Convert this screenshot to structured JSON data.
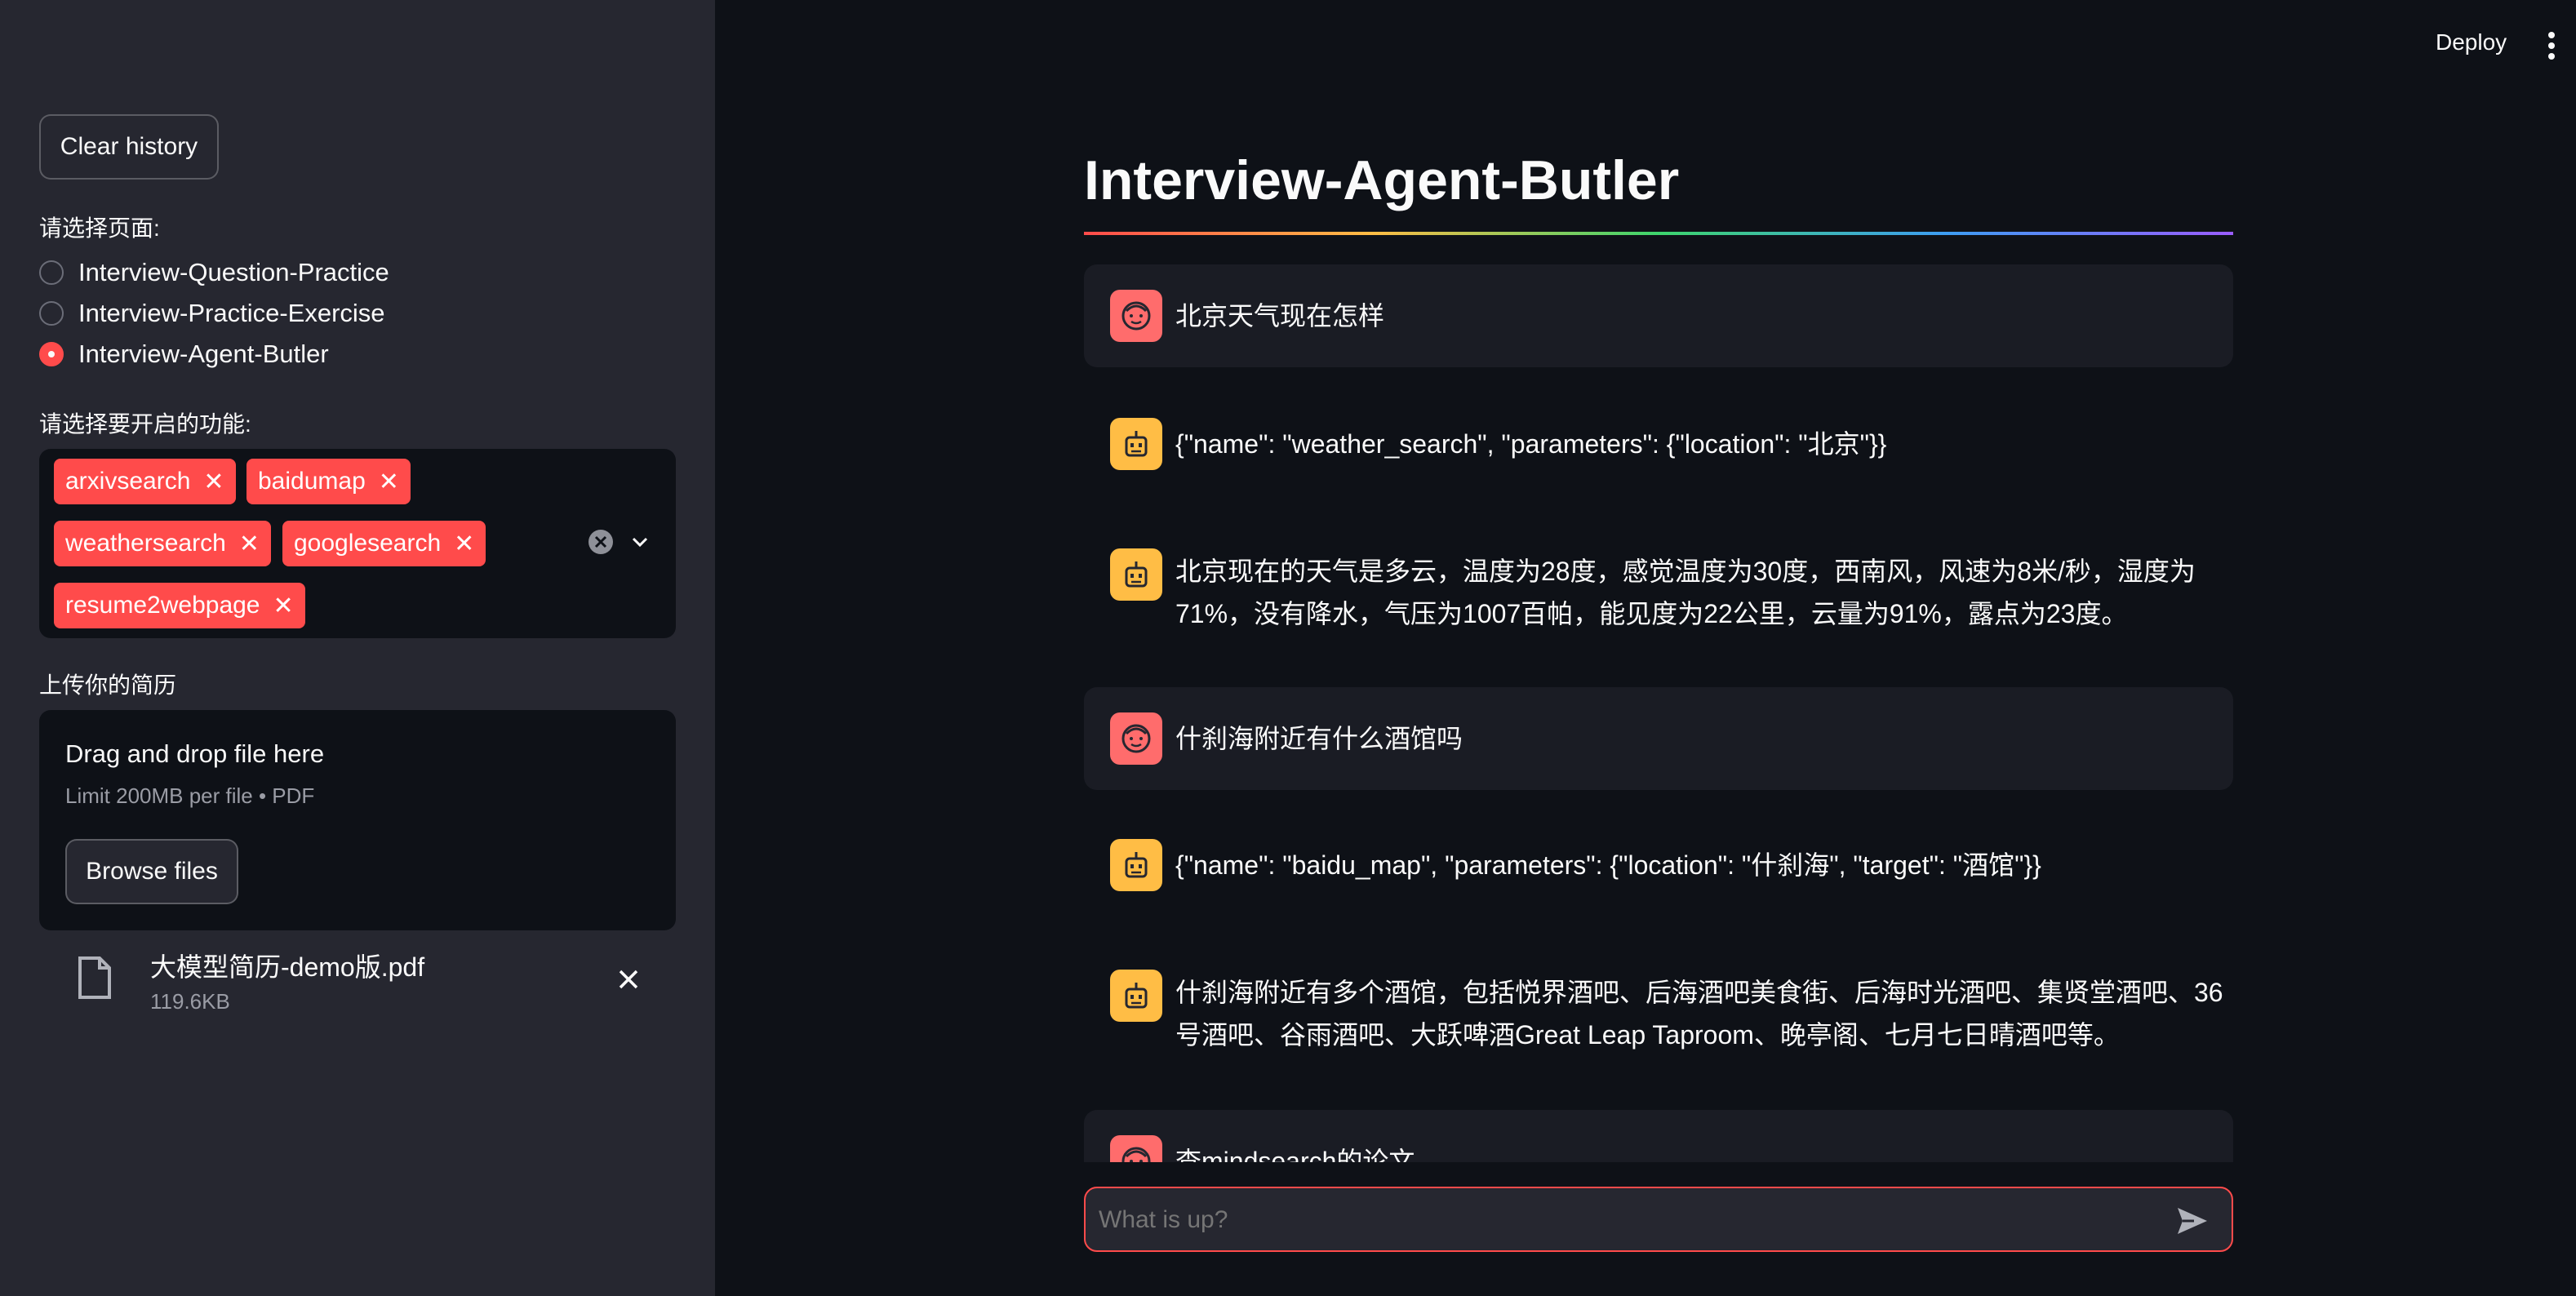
{
  "header": {
    "deploy_label": "Deploy"
  },
  "sidebar": {
    "clear_history_label": "Clear history",
    "page_select_label": "请选择页面:",
    "pages": [
      {
        "label": "Interview-Question-Practice",
        "selected": false
      },
      {
        "label": "Interview-Practice-Exercise",
        "selected": false
      },
      {
        "label": "Interview-Agent-Butler",
        "selected": true
      }
    ],
    "features_label": "请选择要开启的功能:",
    "features": [
      "arxivsearch",
      "baidumap",
      "weathersearch",
      "googlesearch",
      "resume2webpage"
    ],
    "upload_label": "上传你的简历",
    "uploader": {
      "drag_text": "Drag and drop file here",
      "limit_text": "Limit 200MB per file • PDF",
      "browse_label": "Browse files"
    },
    "uploaded_file": {
      "name": "大模型简历-demo版.pdf",
      "size": "119.6KB"
    }
  },
  "main": {
    "title": "Interview-Agent-Butler",
    "messages": [
      {
        "role": "user",
        "text": "北京天气现在怎样"
      },
      {
        "role": "assistant",
        "text": "{\"name\": \"weather_search\", \"parameters\": {\"location\": \"北京\"}}"
      },
      {
        "role": "assistant",
        "text": "北京现在的天气是多云，温度为28度，感觉温度为30度，西南风，风速为8米/秒，湿度为71%，没有降水，气压为1007百帕，能见度为22公里，云量为91%，露点为23度。"
      },
      {
        "role": "user",
        "text": "什刹海附近有什么酒馆吗"
      },
      {
        "role": "assistant",
        "text": "{\"name\": \"baidu_map\", \"parameters\": {\"location\": \"什刹海\", \"target\": \"酒馆\"}}"
      },
      {
        "role": "assistant",
        "text": "什刹海附近有多个酒馆，包括悦界酒吧、后海酒吧美食街、后海时光酒吧、集贤堂酒吧、36号酒吧、谷雨酒吧、大跃啤酒Great Leap Taproom、晚亭阁、七月七日晴酒吧等。"
      },
      {
        "role": "user",
        "text": "查mindsearch的论文"
      }
    ],
    "chat_input": {
      "placeholder": "What is up?"
    }
  },
  "colors": {
    "accent": "#ff4b4b",
    "sidebar_bg": "#262730",
    "main_bg": "#0e1117",
    "user_avatar": "#ff6c6c",
    "bot_avatar": "#ffbd45"
  }
}
